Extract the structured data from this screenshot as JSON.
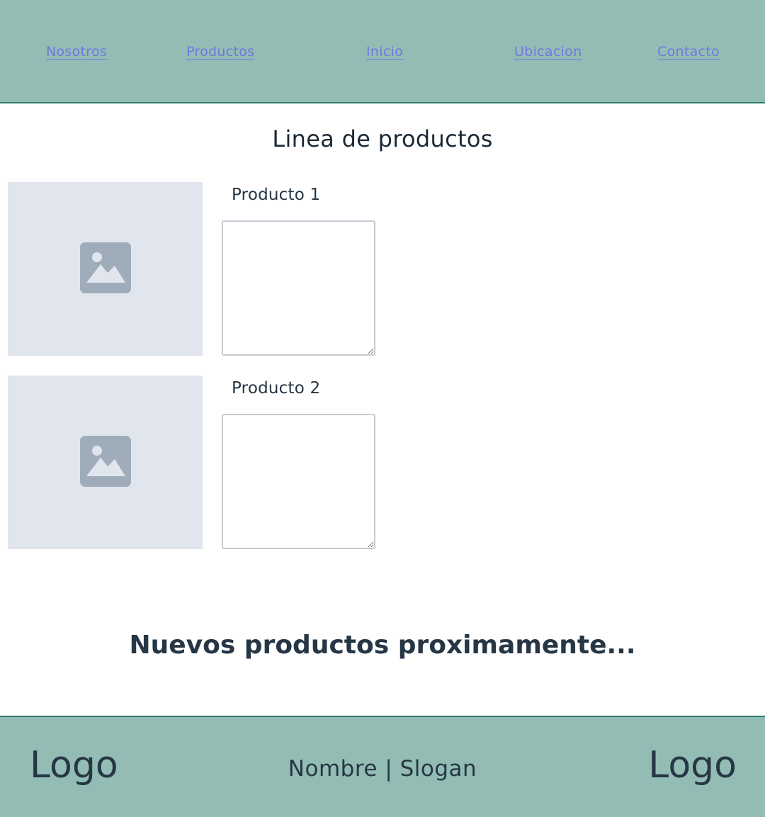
{
  "nav": {
    "items": [
      {
        "label": "Nosotros"
      },
      {
        "label": "Productos"
      },
      {
        "label": "Inicio"
      },
      {
        "label": "Ubicacion"
      },
      {
        "label": "Contacto"
      }
    ]
  },
  "main": {
    "title": "Linea de productos",
    "products": [
      {
        "name": "Producto 1",
        "image_icon": "image-placeholder-icon",
        "description_value": ""
      },
      {
        "name": "Producto 2",
        "image_icon": "image-placeholder-icon",
        "description_value": ""
      }
    ],
    "announcement": "Nuevos productos proximamente..."
  },
  "footer": {
    "logo_left": "Logo",
    "slogan": "Nombre | Slogan",
    "logo_right": "Logo"
  },
  "colors": {
    "bar_background": "#93bdb4",
    "bar_border": "#2f7a6a",
    "nav_link": "#6f78e0",
    "text": "#263645",
    "placeholder_bg": "#e1e6ee",
    "placeholder_icon": "#9fadba"
  }
}
